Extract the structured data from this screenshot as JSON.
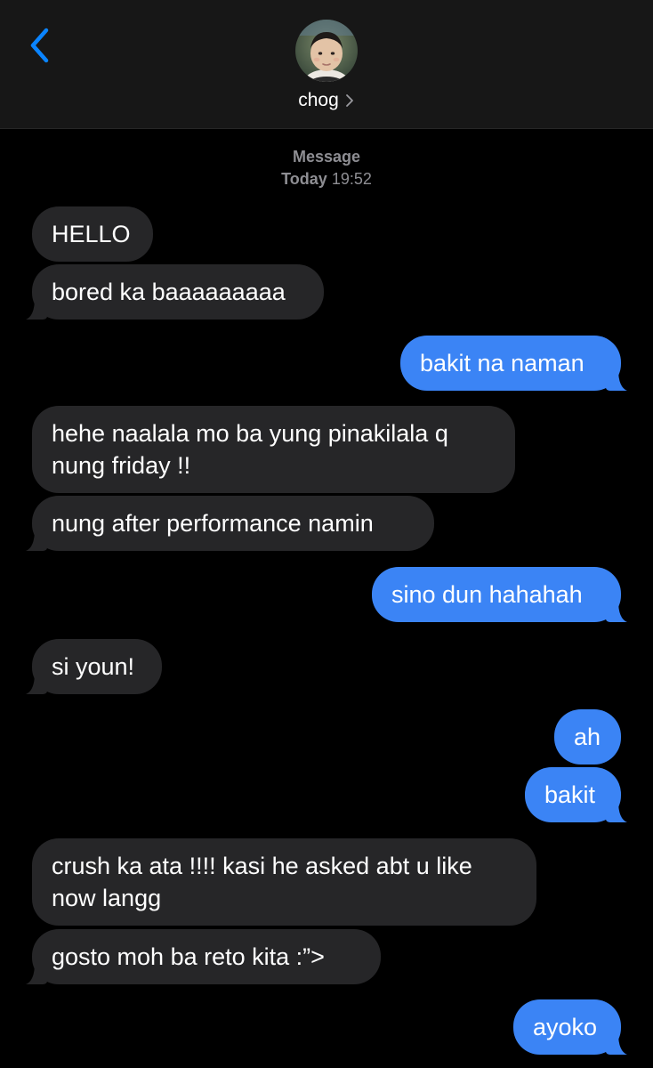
{
  "header": {
    "contact_name": "chog",
    "back_icon": "chevron-left-icon",
    "chevron_icon": "chevron-right-icon",
    "accent_color": "#0a84ff"
  },
  "timestamp": {
    "service": "Message",
    "day": "Today",
    "time": "19:52"
  },
  "colors": {
    "incoming_bubble": "#262628",
    "outgoing_bubble": "#3b84f5",
    "background": "#000000",
    "header_background": "#171717"
  },
  "messages": [
    {
      "direction": "in",
      "text": "HELLO"
    },
    {
      "direction": "in",
      "text": "bored ka baaaaaaaaa"
    },
    {
      "direction": "out",
      "text": "bakit na naman"
    },
    {
      "direction": "in",
      "text": "hehe naalala mo ba yung pinakilala q nung friday !!"
    },
    {
      "direction": "in",
      "text": "nung after performance namin"
    },
    {
      "direction": "out",
      "text": "sino dun hahahah"
    },
    {
      "direction": "in",
      "text": "si youn!"
    },
    {
      "direction": "out",
      "text": "ah"
    },
    {
      "direction": "out",
      "text": "bakit"
    },
    {
      "direction": "in",
      "text": "crush ka ata !!!! kasi he asked abt u like now langg"
    },
    {
      "direction": "in",
      "text": "gosto moh ba reto kita :”>"
    },
    {
      "direction": "out",
      "text": "ayoko"
    }
  ]
}
